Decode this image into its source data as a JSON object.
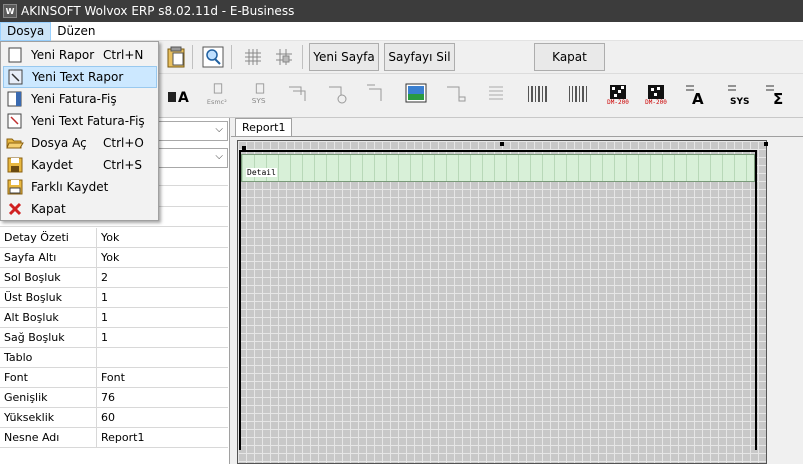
{
  "window": {
    "title": "AKINSOFT Wolvox ERP s8.02.11d - E-Business",
    "app_icon_text": "W"
  },
  "menubar": {
    "items": [
      {
        "label": "Dosya"
      },
      {
        "label": "Düzen"
      }
    ]
  },
  "toolbar": {
    "new_page_label": "Yeni Sayfa",
    "delete_page_label": "Sayfayı Sil",
    "close_label": "Kapat",
    "dm_label": "DM-200",
    "sys_label": "SYS",
    "esmc_label": "Esmc²"
  },
  "file_menu": {
    "items": [
      {
        "label": "Yeni Rapor",
        "shortcut": "Ctrl+N",
        "icon": "page-icon"
      },
      {
        "label": "Yeni Text Rapor",
        "shortcut": "",
        "icon": "text-report-icon"
      },
      {
        "label": "Yeni Fatura-Fiş",
        "shortcut": "",
        "icon": "invoice-icon"
      },
      {
        "label": "Yeni Text Fatura-Fiş",
        "shortcut": "",
        "icon": "text-invoice-icon"
      },
      {
        "label": "Dosya Aç",
        "shortcut": "Ctrl+O",
        "icon": "folder-open-icon"
      },
      {
        "label": "Kaydet",
        "shortcut": "Ctrl+S",
        "icon": "save-icon"
      },
      {
        "label": "Farklı Kaydet",
        "shortcut": "",
        "icon": "save-as-icon"
      },
      {
        "label": "Kapat",
        "shortcut": "",
        "icon": "close-x-icon"
      }
    ]
  },
  "properties": [
    {
      "name": "Detay Özeti",
      "value": "Yok"
    },
    {
      "name": "Sayfa Altı",
      "value": "Yok"
    },
    {
      "name": "Sol Boşluk",
      "value": "2"
    },
    {
      "name": "Üst Boşluk",
      "value": "1"
    },
    {
      "name": "Alt Boşluk",
      "value": "1"
    },
    {
      "name": "Sağ Boşluk",
      "value": "1"
    },
    {
      "name": "Tablo",
      "value": ""
    },
    {
      "name": "Font",
      "value": "Font"
    },
    {
      "name": "Genişlik",
      "value": "76"
    },
    {
      "name": "Yükseklik",
      "value": "60"
    },
    {
      "name": "Nesne Adı",
      "value": "Report1"
    }
  ],
  "design": {
    "tab_label": "Report1",
    "band_label": "Detail"
  },
  "colors": {
    "titlebar": "#3c3c3c",
    "menu_highlight": "#cce8ff",
    "band_fill": "#d8f0d8",
    "grid": "#c8c8c8"
  }
}
